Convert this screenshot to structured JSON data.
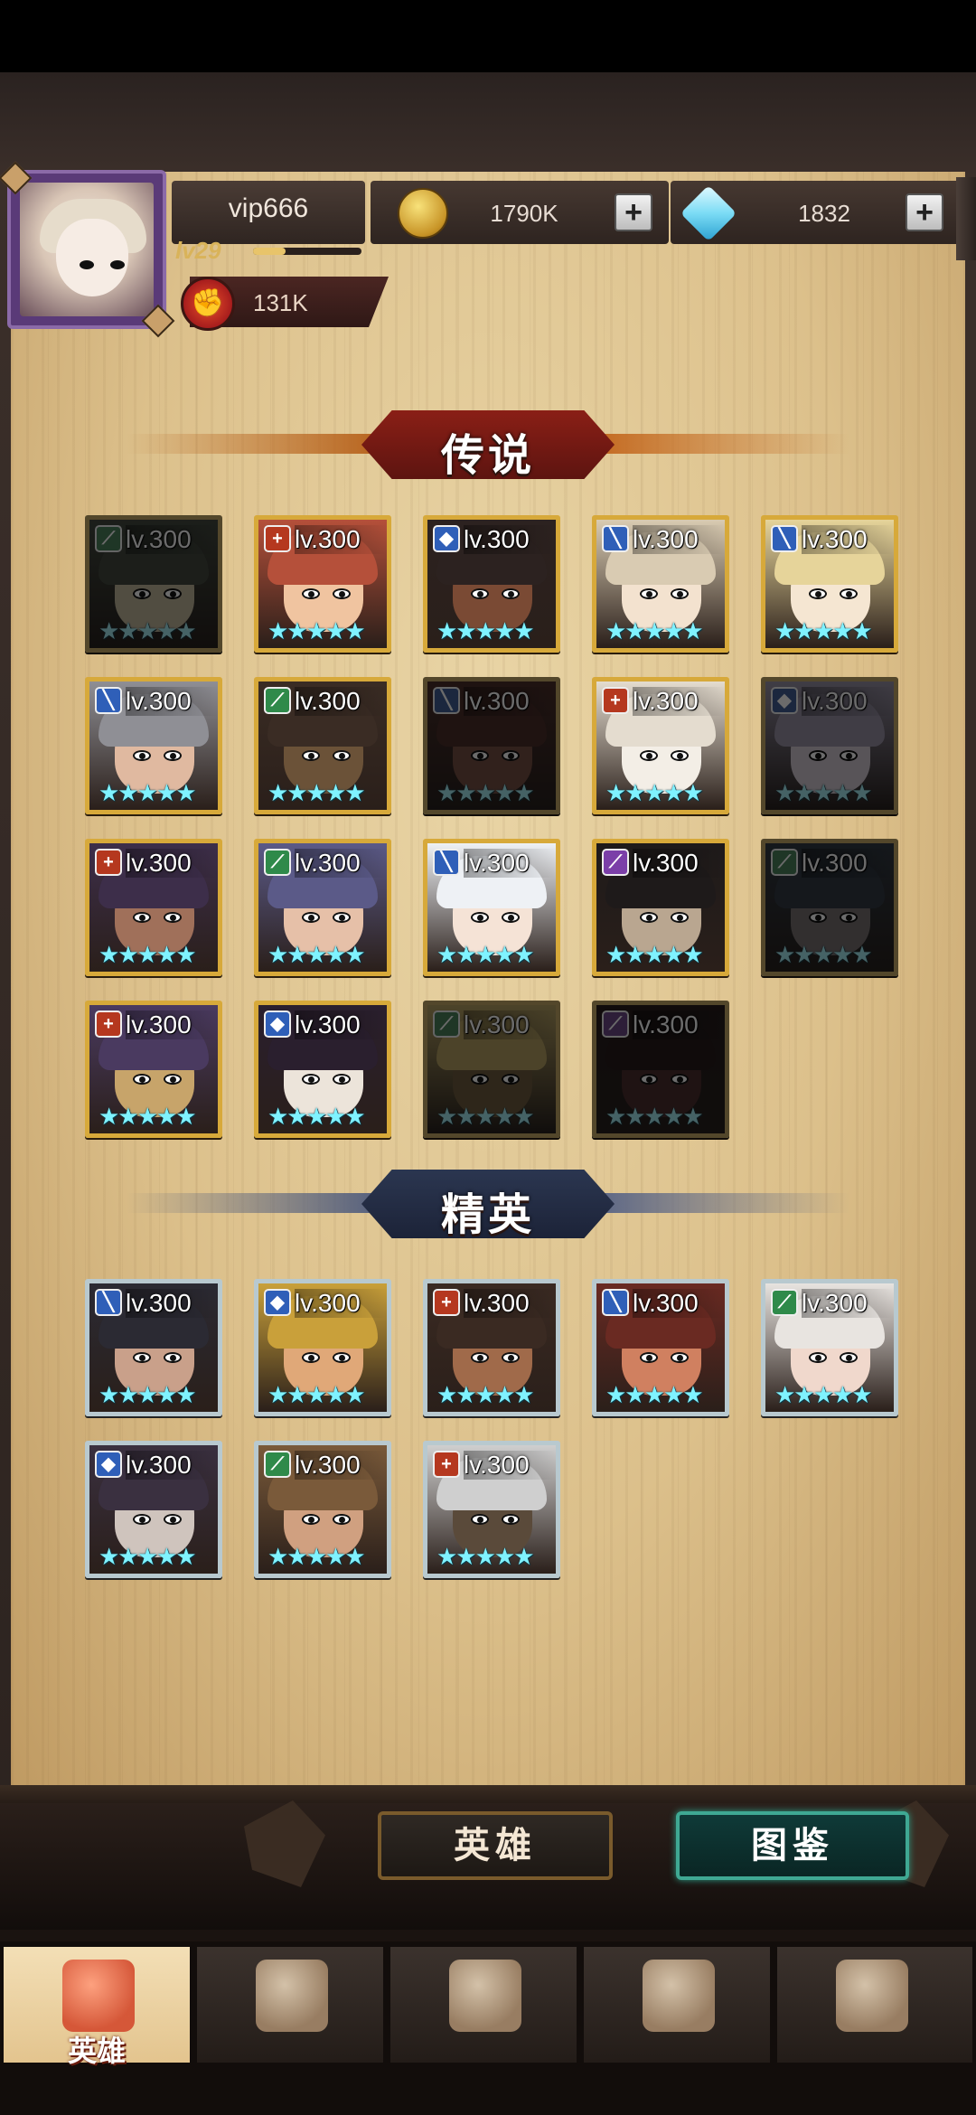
{
  "player": {
    "name": "vip666",
    "level": "lv29",
    "xp_progress": 0.3,
    "power": "131K"
  },
  "resources": [
    {
      "icon": "coin-icon",
      "value": "1790K"
    },
    {
      "icon": "diamond-icon",
      "value": "1832"
    }
  ],
  "sections": {
    "legend": {
      "title": "传说"
    },
    "elite": {
      "title": "精英"
    }
  },
  "legend_heroes": [
    {
      "level": "lv.300",
      "role": "ranger",
      "owned": false,
      "palette": [
        "#3f4a3a",
        "#c9b68a"
      ]
    },
    {
      "level": "lv.300",
      "role": "support",
      "owned": true,
      "palette": [
        "#b5503a",
        "#f0c4a0"
      ]
    },
    {
      "level": "lv.300",
      "role": "tank",
      "owned": true,
      "palette": [
        "#2c2220",
        "#7a4a34"
      ]
    },
    {
      "level": "lv.300",
      "role": "warrior",
      "owned": true,
      "palette": [
        "#d9cbb2",
        "#f3e2cf"
      ]
    },
    {
      "level": "lv.300",
      "role": "warrior",
      "owned": true,
      "palette": [
        "#e6d49a",
        "#f5e6d2"
      ]
    },
    {
      "level": "lv.300",
      "role": "warrior",
      "owned": true,
      "palette": [
        "#8f8f95",
        "#e0b9a0"
      ]
    },
    {
      "level": "lv.300",
      "role": "ranger",
      "owned": true,
      "palette": [
        "#3a2c24",
        "#6b5238"
      ]
    },
    {
      "level": "lv.300",
      "role": "warrior",
      "owned": false,
      "palette": [
        "#5a2a22",
        "#8a4a36"
      ]
    },
    {
      "level": "lv.300",
      "role": "support",
      "owned": true,
      "palette": [
        "#e4dccf",
        "#f3eee6"
      ]
    },
    {
      "level": "lv.300",
      "role": "tank",
      "owned": false,
      "palette": [
        "#9a8fb0",
        "#d5c7d5"
      ]
    },
    {
      "level": "lv.300",
      "role": "support",
      "owned": true,
      "palette": [
        "#3d2e4a",
        "#a0705a"
      ]
    },
    {
      "level": "lv.300",
      "role": "ranger",
      "owned": true,
      "palette": [
        "#5b5a88",
        "#e6c0a8"
      ]
    },
    {
      "level": "lv.300",
      "role": "warrior",
      "owned": true,
      "palette": [
        "#eef1f5",
        "#f5e3d6"
      ]
    },
    {
      "level": "lv.300",
      "role": "mage",
      "owned": true,
      "palette": [
        "#1e1a1a",
        "#b9a690"
      ]
    },
    {
      "level": "lv.300",
      "role": "ranger",
      "owned": false,
      "palette": [
        "#2c3a4a",
        "#7a6e70"
      ]
    },
    {
      "level": "lv.300",
      "role": "support",
      "owned": true,
      "palette": [
        "#4a3a60",
        "#c7a46a"
      ]
    },
    {
      "level": "lv.300",
      "role": "tank",
      "owned": true,
      "palette": [
        "#2a1f2e",
        "#ece4da"
      ]
    },
    {
      "level": "lv.300",
      "role": "ranger",
      "owned": false,
      "palette": [
        "#c2a03a",
        "#7a5a2a"
      ]
    },
    {
      "level": "lv.300",
      "role": "mage",
      "owned": false,
      "palette": [
        "#2a1a1a",
        "#5a2a2a"
      ]
    }
  ],
  "elite_heroes": [
    {
      "level": "lv.300",
      "role": "warrior",
      "owned": true,
      "palette": [
        "#2b2a33",
        "#c9a08a"
      ]
    },
    {
      "level": "lv.300",
      "role": "tank",
      "owned": true,
      "palette": [
        "#c9a03a",
        "#e0a878"
      ]
    },
    {
      "level": "lv.300",
      "role": "support",
      "owned": true,
      "palette": [
        "#3a2a22",
        "#a06a4a"
      ]
    },
    {
      "level": "lv.300",
      "role": "warrior",
      "owned": true,
      "palette": [
        "#6a2a22",
        "#d08060"
      ]
    },
    {
      "level": "lv.300",
      "role": "ranger",
      "owned": true,
      "palette": [
        "#e8e4e0",
        "#f0d8cc"
      ]
    },
    {
      "level": "lv.300",
      "role": "tank",
      "owned": true,
      "palette": [
        "#3a3040",
        "#cfc4bd"
      ]
    },
    {
      "level": "lv.300",
      "role": "ranger",
      "owned": true,
      "palette": [
        "#7a5a3a",
        "#d0a080"
      ]
    },
    {
      "level": "lv.300",
      "role": "support",
      "owned": true,
      "palette": [
        "#cfcfcf",
        "#5a4a3a"
      ]
    }
  ],
  "role_colors": {
    "warrior": "#2f5fb8",
    "support": "#b5381f",
    "tank": "#2f5fb8",
    "ranger": "#2f8a4a",
    "mage": "#7b3fa8"
  },
  "role_glyphs": {
    "warrior": "╲",
    "support": "+",
    "tank": "◆",
    "ranger": "⟋",
    "mage": "⟋"
  },
  "stars": "★★★★★",
  "toggle": {
    "hero_label": "英雄",
    "codex_label": "图鉴",
    "selected": "codex"
  },
  "nav": [
    {
      "icon": "helmet-icon",
      "label": "英雄",
      "active": true
    },
    {
      "icon": "banner-flag-icon",
      "label": "",
      "active": false
    },
    {
      "icon": "crossed-swords-icon",
      "label": "",
      "active": false
    },
    {
      "icon": "castle-tower-icon",
      "label": "",
      "active": false
    },
    {
      "icon": "guild-shield-icon",
      "label": "",
      "active": false
    }
  ]
}
